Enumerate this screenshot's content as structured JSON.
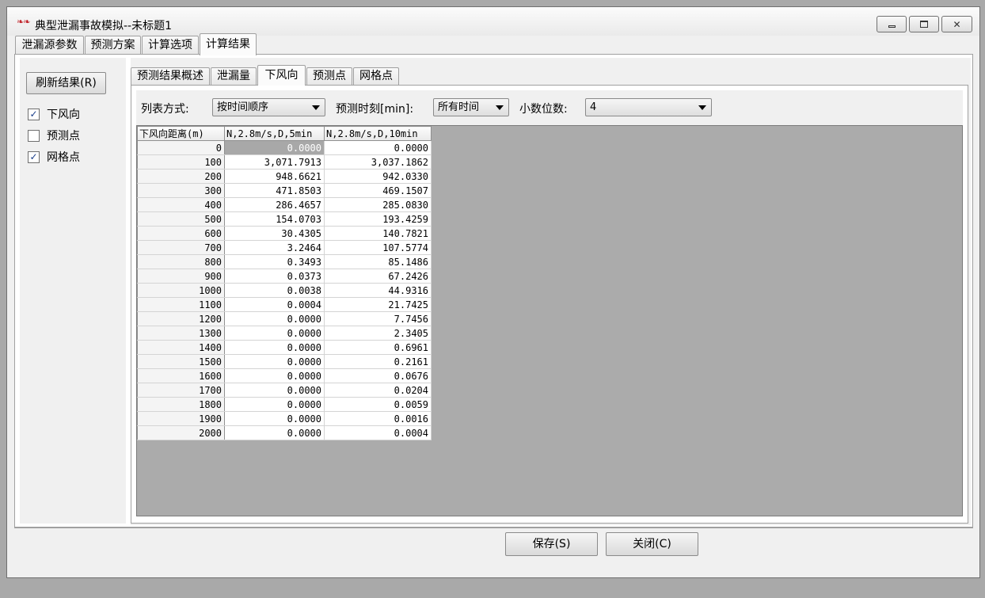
{
  "window": {
    "title": "典型泄漏事故模拟--未标题1",
    "icon": "app-logo-icon",
    "controls": {
      "minimize": "minimize-icon",
      "maximize": "maximize-icon",
      "close_label": "✕"
    }
  },
  "outer_tabs": [
    {
      "label": "泄漏源参数",
      "active": false
    },
    {
      "label": "预测方案",
      "active": false
    },
    {
      "label": "计算选项",
      "active": false
    },
    {
      "label": "计算结果",
      "active": true
    }
  ],
  "left_panel": {
    "refresh_label": "刷新结果(R)",
    "checkboxes": [
      {
        "label": "下风向",
        "checked": true
      },
      {
        "label": "预测点",
        "checked": false
      },
      {
        "label": "网格点",
        "checked": true
      }
    ]
  },
  "inner_tabs": [
    {
      "label": "预测结果概述",
      "active": false
    },
    {
      "label": "泄漏量",
      "active": false
    },
    {
      "label": "下风向",
      "active": true
    },
    {
      "label": "预测点",
      "active": false
    },
    {
      "label": "网格点",
      "active": false
    }
  ],
  "options": {
    "list_mode_label": "列表方式:",
    "list_mode_value": "按时间顺序",
    "time_label": "预测时刻[min]:",
    "time_value": "所有时间",
    "decimals_label": "小数位数:",
    "decimals_value": "4"
  },
  "grid": {
    "columns": [
      "下风向距离(m)",
      "N,2.8m/s,D,5min",
      "N,2.8m/s,D,10min"
    ],
    "rows": [
      [
        "0",
        "0.0000",
        "0.0000"
      ],
      [
        "100",
        "3,071.7913",
        "3,037.1862"
      ],
      [
        "200",
        "948.6621",
        "942.0330"
      ],
      [
        "300",
        "471.8503",
        "469.1507"
      ],
      [
        "400",
        "286.4657",
        "285.0830"
      ],
      [
        "500",
        "154.0703",
        "193.4259"
      ],
      [
        "600",
        "30.4305",
        "140.7821"
      ],
      [
        "700",
        "3.2464",
        "107.5774"
      ],
      [
        "800",
        "0.3493",
        "85.1486"
      ],
      [
        "900",
        "0.0373",
        "67.2426"
      ],
      [
        "1000",
        "0.0038",
        "44.9316"
      ],
      [
        "1100",
        "0.0004",
        "21.7425"
      ],
      [
        "1200",
        "0.0000",
        "7.7456"
      ],
      [
        "1300",
        "0.0000",
        "2.3405"
      ],
      [
        "1400",
        "0.0000",
        "0.6961"
      ],
      [
        "1500",
        "0.0000",
        "0.2161"
      ],
      [
        "1600",
        "0.0000",
        "0.0676"
      ],
      [
        "1700",
        "0.0000",
        "0.0204"
      ],
      [
        "1800",
        "0.0000",
        "0.0059"
      ],
      [
        "1900",
        "0.0000",
        "0.0016"
      ],
      [
        "2000",
        "0.0000",
        "0.0004"
      ]
    ]
  },
  "footer": {
    "save_label": "保存(S)",
    "close_label": "关闭(C)"
  }
}
